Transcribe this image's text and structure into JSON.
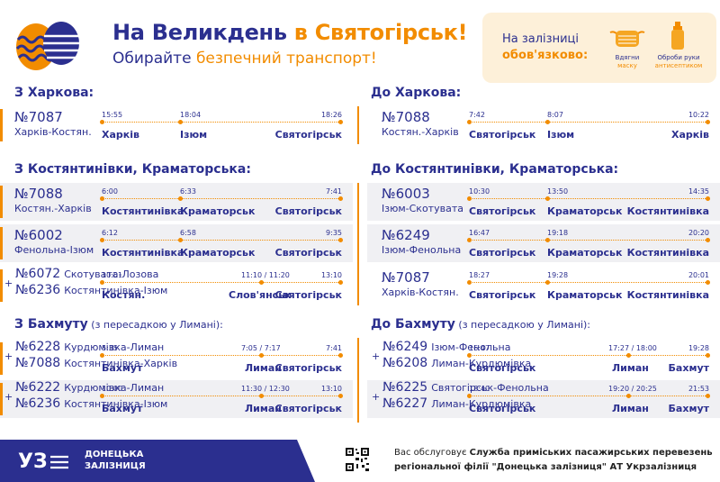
{
  "header": {
    "title_main": "На Великдень ",
    "title_accent": "в Святогірськ!",
    "subtitle_main": "Обирайте ",
    "subtitle_accent": "безпечний транспорт!"
  },
  "notice": {
    "line1": "На залізниці",
    "line2": "обов'язково:",
    "mask_label1": "Вдягни",
    "mask_label2": "маску",
    "sanitizer_label1": "Оброби руки",
    "sanitizer_label2": "антисептиком"
  },
  "sections": {
    "from_kharkiv": "З Харкова:",
    "to_kharkiv": "До Харкова:",
    "from_kost": "З Костянтинівки, Краматорська:",
    "to_kost": "До Костянтинівки, Краматорська:",
    "from_bakhmut": "З Бахмуту",
    "from_bakhmut_note": " (з пересадкою у Лимані):",
    "to_bakhmut": "До Бахмуту",
    "to_bakhmut_note": " (з пересадкою у Лимані):"
  },
  "rows": [
    {
      "train": "№7087",
      "route": "Харків-Костян.",
      "times": [
        "15:55",
        "18:04",
        "18:26"
      ],
      "stations": [
        "Харків",
        "Ізюм",
        "Святогірськ"
      ]
    },
    {
      "train": "№7088",
      "route": "Костян.-Харків",
      "times": [
        "7:42",
        "8:07",
        "10:22"
      ],
      "stations": [
        "Святогірськ",
        "Ізюм",
        "Харків"
      ]
    },
    {
      "train": "№7088",
      "route": "Костян.-Харків",
      "times": [
        "6:00",
        "6:33",
        "7:41"
      ],
      "stations": [
        "Костянтинівка",
        "Краматорськ",
        "Святогірськ"
      ]
    },
    {
      "train": "№6003",
      "route": "Ізюм-Скотувата",
      "times": [
        "10:30",
        "13:50",
        "14:35"
      ],
      "stations": [
        "Святогірськ",
        "Краматорськ",
        "Костянтинівка"
      ]
    },
    {
      "train": "№6002",
      "route": "Фенольна-Ізюм",
      "times": [
        "6:12",
        "6:58",
        "9:35"
      ],
      "stations": [
        "Костянтинівка",
        "Краматорськ",
        "Святогірськ"
      ]
    },
    {
      "train": "№6249",
      "route": "Ізюм-Фенольна",
      "times": [
        "16:47",
        "19:18",
        "20:20"
      ],
      "stations": [
        "Святогірськ",
        "Краматорськ",
        "Костянтинівка"
      ]
    },
    {
      "train1": "№6072",
      "route1": "Скотувата-Лозова",
      "train2": "№6236",
      "route2": "Костянтинівка-Ізюм",
      "times": [
        "10:01",
        "11:10 / 11:20",
        "13:10"
      ],
      "stations": [
        "Костян.",
        "Слов'янськ",
        "Святогірськ"
      ]
    },
    {
      "train": "№7087",
      "route": "Харків-Костян.",
      "times": [
        "18:27",
        "19:28",
        "20:01"
      ],
      "stations": [
        "Святогірськ",
        "Краматорськ",
        "Костянтинівка"
      ]
    },
    {
      "train1": "№6228",
      "route1": "Курдюмівка-Лиман",
      "train2": "№7088",
      "route2": "Костянтинівка-Харків",
      "times": [
        "5:35",
        "7:05 / 7:17",
        "7:41"
      ],
      "stations": [
        "Бахмут",
        "Лиман",
        "Святогірськ"
      ]
    },
    {
      "train1": "№6249",
      "route1": "Ізюм-Фенольна",
      "train2": "№6208",
      "route2": "Лиман-Курдюмівка",
      "times": [
        "16:47",
        "17:27 / 18:00",
        "19:28"
      ],
      "stations": [
        "Святогірськ",
        "Лиман",
        "Бахмут"
      ]
    },
    {
      "train1": "№6222",
      "route1": "Курдюмівка-Лиман",
      "train2": "№6236",
      "route2": "Костянтинівка-Ізюм",
      "times": [
        "10:00",
        "11:30 / 12:30",
        "13:10"
      ],
      "stations": [
        "Бахмут",
        "Лиман",
        "Святогірськ"
      ]
    },
    {
      "train1": "№6225",
      "route1": "Святогірськ-Фенольна",
      "train2": "№6227",
      "route2": "Лиман-Курдюмівка",
      "times": [
        "18:40",
        "19:20 / 20:25",
        "21:53"
      ],
      "stations": [
        "Святогірськ",
        "Лиман",
        "Бахмут"
      ]
    }
  ],
  "footer": {
    "logo_text": "УЗ",
    "org_line1": "ДОНЕЦЬКА",
    "org_line2": "ЗАЛІЗНИЦЯ",
    "text1_a": "Вас обслуговує ",
    "text1_b": "Служба приміських пасажирських перевезень",
    "text2_a": "регіональної філії  \"Донецька залізниця\"",
    "text2_b": " АТ Укрзалізниця"
  },
  "colors": {
    "brand": "#2b2f8f",
    "accent": "#f28c00",
    "shade": "#f0f0f3"
  }
}
